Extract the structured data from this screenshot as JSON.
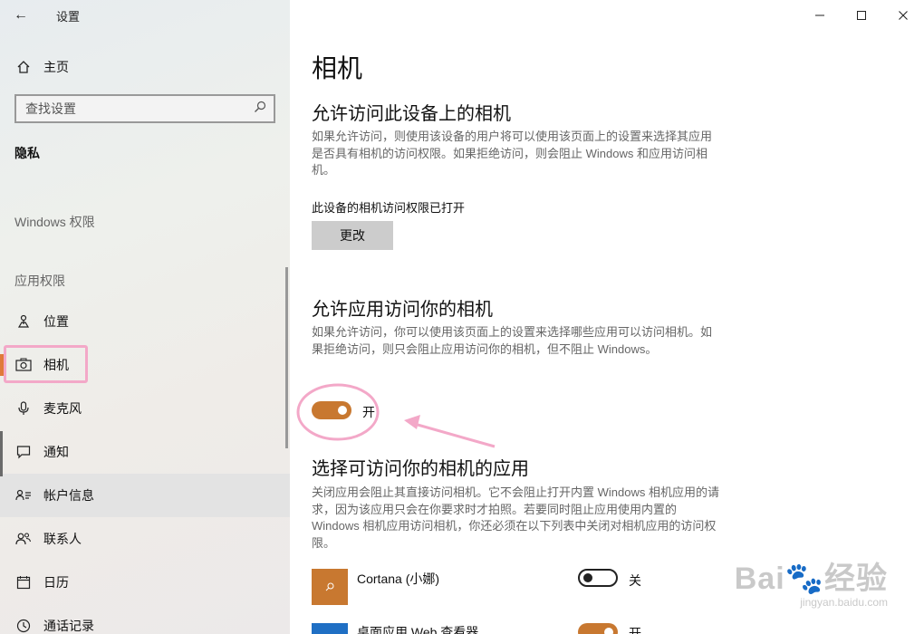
{
  "window": {
    "title": "设置",
    "back_glyph": "←",
    "minimize_glyph": "—",
    "close_glyph": "✕"
  },
  "sidebar": {
    "home_label": "主页",
    "search_placeholder": "查找设置",
    "section_current": "隐私",
    "group_windows": "Windows 权限",
    "group_apps": "应用权限",
    "items": [
      {
        "label": "位置",
        "icon": "location-icon"
      },
      {
        "label": "相机",
        "icon": "camera-icon",
        "active": true
      },
      {
        "label": "麦克风",
        "icon": "microphone-icon"
      },
      {
        "label": "通知",
        "icon": "notification-icon"
      },
      {
        "label": "帐户信息",
        "icon": "account-info-icon"
      },
      {
        "label": "联系人",
        "icon": "contacts-icon"
      },
      {
        "label": "日历",
        "icon": "calendar-icon"
      },
      {
        "label": "通话记录",
        "icon": "call-history-icon"
      }
    ],
    "accent_color": "#e07a3a"
  },
  "main": {
    "page_title": "相机",
    "device_section": {
      "heading": "允许访问此设备上的相机",
      "paragraph": "如果允许访问，则使用该设备的用户将可以使用该页面上的设置来选择其应用是否具有相机的访问权限。如果拒绝访问，则会阻止 Windows 和应用访问相机。",
      "status": "此设备的相机访问权限已打开",
      "button": "更改"
    },
    "apps_section": {
      "heading": "允许应用访问你的相机",
      "paragraph": "如果允许访问，你可以使用该页面上的设置来选择哪些应用可以访问相机。如果拒绝访问，则只会阻止应用访问你的相机，但不阻止 Windows。",
      "toggle_label": "开",
      "toggle_on": true
    },
    "choose_section": {
      "heading": "选择可访问你的相机的应用",
      "paragraph": "关闭应用会阻止其直接访问相机。它不会阻止打开内置 Windows 相机应用的请求，因为该应用只会在你要求时才拍照。若要同时阻止应用使用内置的 Windows 相机应用访问相机，你还必须在以下列表中关闭对相机应用的访问权限。",
      "apps": [
        {
          "name": "Cortana (小娜)",
          "toggle_label": "关",
          "on": false,
          "tile_color": "#c87830"
        },
        {
          "name": "桌面应用 Web 查看器",
          "toggle_label": "开",
          "on": true,
          "tile_color": "#1f6fc4"
        }
      ]
    },
    "toggle_on_color": "#c87830"
  },
  "watermark": {
    "main": "Bai🐾经验",
    "sub": "jingyan.baidu.com"
  },
  "annotation_color": "#f3a8c8"
}
